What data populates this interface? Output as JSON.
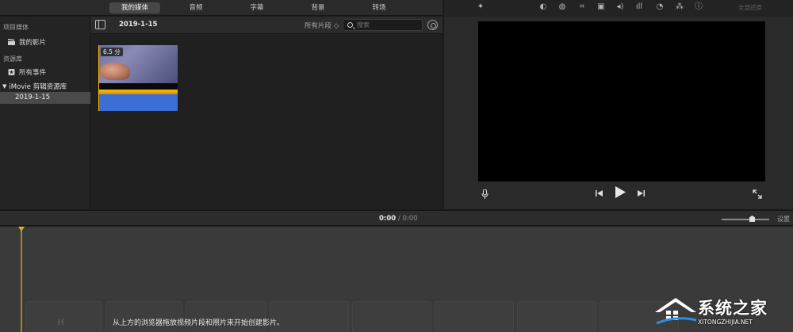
{
  "tabs": [
    {
      "label": "我的媒体",
      "active": true
    },
    {
      "label": "音频",
      "active": false
    },
    {
      "label": "字幕",
      "active": false
    },
    {
      "label": "背景",
      "active": false
    },
    {
      "label": "转场",
      "active": false
    }
  ],
  "sidebar": {
    "project_media_header": "项目媒体",
    "my_movie": "我的影片",
    "library_header": "资源库",
    "all_events": "所有事件",
    "library_name": "iMovie 剪辑资源库",
    "selected_event": "2019-1-15"
  },
  "browser": {
    "event_title": "2019-1-15",
    "filter_label": "所有片段 ◇",
    "search_placeholder": "搜索",
    "clip_duration": "6.5 分"
  },
  "viewer": {
    "reset_all": "全部还原",
    "toolbar_icons": [
      "magic-wand",
      "color-balance",
      "color-correction",
      "crop",
      "stabilization",
      "volume",
      "noise-reduction",
      "speed",
      "clip-filter",
      "info"
    ]
  },
  "timeline": {
    "current_time": "0:00",
    "separator": "/",
    "total_time": "0:00",
    "settings_label": "设置",
    "hint": "从上方的浏览器拖放视频片段和照片来开始创建影片。",
    "ghost_letter": "H"
  },
  "watermark": {
    "name": "系统之家",
    "url": "XITONGZHIJIA.NET"
  }
}
